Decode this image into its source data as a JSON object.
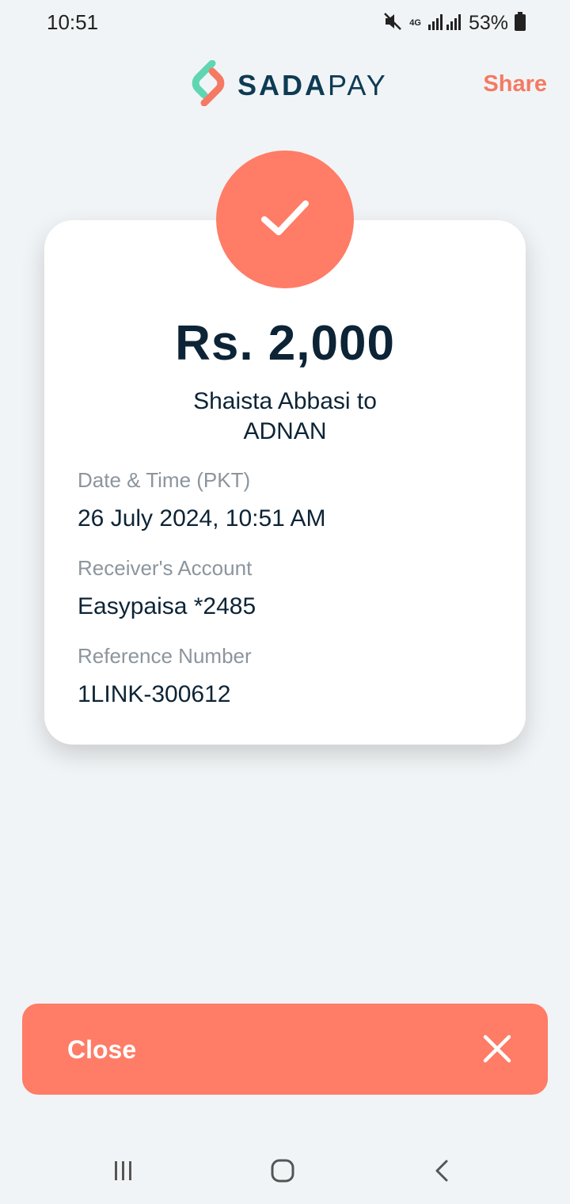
{
  "status_bar": {
    "time": "10:51",
    "network": "4G",
    "battery": "53%"
  },
  "header": {
    "logo_strong": "SADA",
    "logo_light": "PAY",
    "share_label": "Share"
  },
  "receipt": {
    "amount": "Rs. 2,000",
    "parties_line1": "Shaista Abbasi to",
    "parties_line2": "ADNAN",
    "details": [
      {
        "label": "Date & Time (PKT)",
        "value": "26 July 2024, 10:51 AM"
      },
      {
        "label": "Receiver's Account",
        "value": "Easypaisa *2485"
      },
      {
        "label": "Reference Number",
        "value": "1LINK-300612"
      }
    ]
  },
  "footer": {
    "close_label": "Close"
  },
  "colors": {
    "accent": "#ff7c66",
    "share_text": "#f47a64",
    "navy": "#0d2436",
    "background": "#f1f4f6"
  },
  "icons": [
    "mute-icon",
    "signal-icon",
    "battery-icon",
    "sadapay-logo-icon",
    "checkmark-icon",
    "close-icon",
    "recent-apps-icon",
    "home-icon",
    "back-icon"
  ]
}
